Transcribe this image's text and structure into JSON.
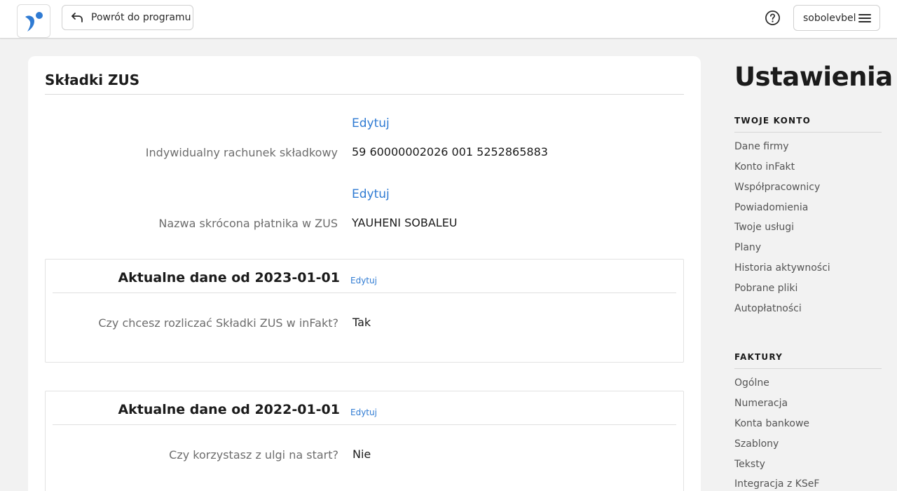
{
  "header": {
    "back_label": "Powrót do programu",
    "username": "sobolevbel",
    "icons": {
      "logo": "infakt-logo",
      "back": "undo-arrow-icon",
      "help": "question-circle-icon",
      "menu": "hamburger-menu-icon"
    }
  },
  "card": {
    "title": "Składki ZUS",
    "fields": [
      {
        "edit_label": "Edytuj",
        "label": "Indywidualny rachunek składkowy",
        "value": "59 60000002026 001 5252865883"
      },
      {
        "edit_label": "Edytuj",
        "label": "Nazwa skrócona płatnika w ZUS",
        "value": "YAUHENI SOBALEU"
      }
    ],
    "sections": [
      {
        "title": "Aktualne dane od 2023-01-01",
        "edit_label": "Edytuj",
        "question": "Czy chcesz rozliczać Składki ZUS w inFakt?",
        "answer": "Tak"
      },
      {
        "title": "Aktualne dane od 2022-01-01",
        "edit_label": "Edytuj",
        "question": "Czy korzystasz z ulgi na start?",
        "answer": "Nie"
      }
    ]
  },
  "sidebar": {
    "heading": "Ustawienia",
    "groups": [
      {
        "title": "TWOJE KONTO",
        "items": [
          "Dane firmy",
          "Konto inFakt",
          "Współpracownicy",
          "Powiadomienia",
          "Twoje usługi",
          "Plany",
          "Historia aktywności",
          "Pobrane pliki",
          "Autopłatności"
        ]
      },
      {
        "title": "FAKTURY",
        "items": [
          "Ogólne",
          "Numeracja",
          "Konta bankowe",
          "Szablony",
          "Teksty",
          "Integracja z KSeF"
        ]
      }
    ]
  },
  "colors": {
    "link": "#2f7bd3",
    "brand": "#2f7bd3",
    "background": "#f2f2f2"
  }
}
